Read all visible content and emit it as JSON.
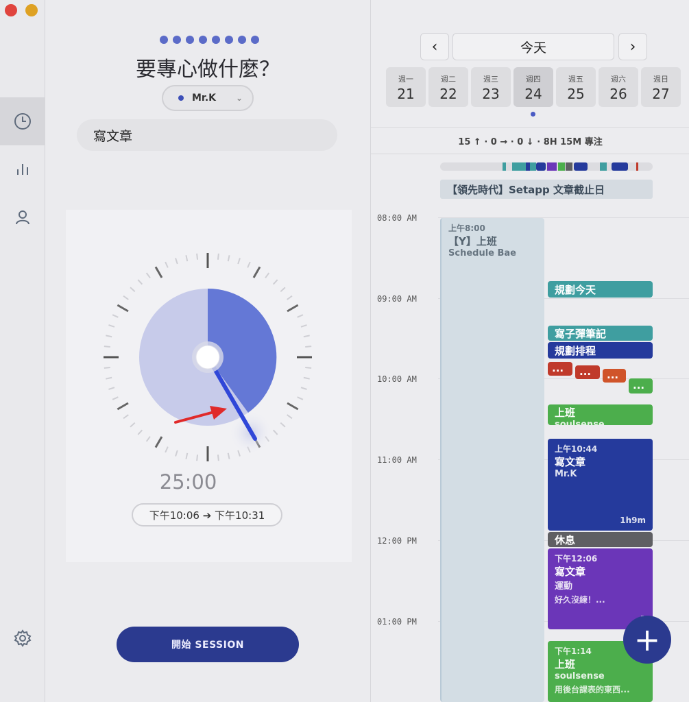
{
  "focus": {
    "title": "要專心做什麼？",
    "project": "Mr.K",
    "task_value": "寫文章",
    "timer": "25:00",
    "range": "下午10:06 ➔ 下午10:31",
    "start_label": "開始 SESSION"
  },
  "calendar": {
    "today_label": "今天",
    "prev_icon": "chevron-left-icon",
    "next_icon": "chevron-right-icon",
    "days": [
      {
        "wd": "週一",
        "dn": "21"
      },
      {
        "wd": "週二",
        "dn": "22"
      },
      {
        "wd": "週三",
        "dn": "23"
      },
      {
        "wd": "週四",
        "dn": "24"
      },
      {
        "wd": "週五",
        "dn": "25"
      },
      {
        "wd": "週六",
        "dn": "26"
      },
      {
        "wd": "週日",
        "dn": "27"
      }
    ],
    "stats": "15 ↑ · 0 → · 0 ↓ · 8H 15M 專注",
    "allday_event": "【領先時代】Setapp 文章截止日",
    "hours": [
      "08:00 AM",
      "09:00 AM",
      "10:00 AM",
      "11:00 AM",
      "12:00 PM",
      "01:00 PM"
    ],
    "events": {
      "work": {
        "time": "上午8:00",
        "name": "【Y】上班",
        "sub": "Schedule Bae"
      },
      "plan_today": "規劃今天",
      "notes": "寫子彈筆記",
      "schedule": "規劃排程",
      "dots": "...",
      "work2": {
        "name": "上班",
        "sub": "soulsense"
      },
      "write": {
        "time": "上午10:44",
        "name": "寫文章",
        "sub": "Mr.K",
        "dur": "1h9m"
      },
      "rest": "休息",
      "write2": {
        "time": "下午12:06",
        "name": "寫文章",
        "sub": "運動",
        "note": "好久沒練！...",
        "dur": "1"
      },
      "work3": {
        "time": "下午1:14",
        "name": "上班",
        "sub": "soulsense",
        "note": "用後台課表的東西..."
      }
    },
    "colors": {
      "teal": "#3f9ea0",
      "navy": "#253a9c",
      "purple": "#6b36b8",
      "green": "#4cae4c",
      "gray": "#5f5f63",
      "red": "#c03a2b"
    }
  }
}
